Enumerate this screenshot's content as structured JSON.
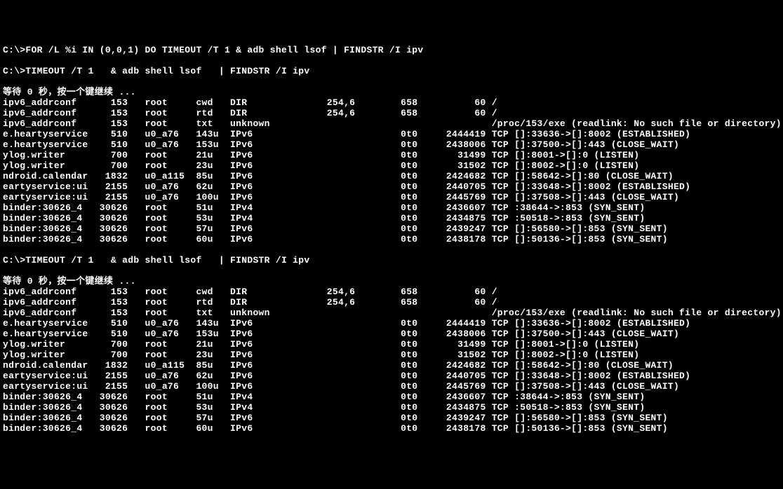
{
  "lines": [
    {
      "type": "cmd",
      "text": "C:\\>FOR /L %i IN (0,0,1) DO TIMEOUT /T 1 & adb shell lsof | FINDSTR /I ipv"
    },
    {
      "type": "blank",
      "text": ""
    },
    {
      "type": "cmd",
      "text": "C:\\>TIMEOUT /T 1   & adb shell lsof   | FINDSTR /I ipv"
    },
    {
      "type": "blank",
      "text": ""
    },
    {
      "type": "wait",
      "text": "等待 0 秒，按一个键继续 ..."
    },
    {
      "type": "row",
      "c0": "ipv6_addrconf",
      "c1": "153",
      "c2": "root",
      "c3": "cwd",
      "c4": "DIR",
      "c5": "254,6",
      "c6": "658",
      "c7": "60",
      "c8": "/"
    },
    {
      "type": "row",
      "c0": "ipv6_addrconf",
      "c1": "153",
      "c2": "root",
      "c3": "rtd",
      "c4": "DIR",
      "c5": "254,6",
      "c6": "658",
      "c7": "60",
      "c8": "/"
    },
    {
      "type": "row",
      "c0": "ipv6_addrconf",
      "c1": "153",
      "c2": "root",
      "c3": "txt",
      "c4": "unknown",
      "c5": "",
      "c6": "",
      "c7": "",
      "c8": "/proc/153/exe (readlink: No such file or directory)"
    },
    {
      "type": "row",
      "c0": "e.heartyservice",
      "c1": "510",
      "c2": "u0_a76",
      "c3": "143u",
      "c4": "IPv6",
      "c5": "",
      "c6": "0t0",
      "c7": "2444419",
      "c8": "TCP []:33636->[]:8002 (ESTABLISHED)"
    },
    {
      "type": "row",
      "c0": "e.heartyservice",
      "c1": "510",
      "c2": "u0_a76",
      "c3": "153u",
      "c4": "IPv6",
      "c5": "",
      "c6": "0t0",
      "c7": "2438006",
      "c8": "TCP []:37500->[]:443 (CLOSE_WAIT)"
    },
    {
      "type": "row",
      "c0": "ylog.writer",
      "c1": "700",
      "c2": "root",
      "c3": "21u",
      "c4": "IPv6",
      "c5": "",
      "c6": "0t0",
      "c7": "31499",
      "c8": "TCP []:8001->[]:0 (LISTEN)"
    },
    {
      "type": "row",
      "c0": "ylog.writer",
      "c1": "700",
      "c2": "root",
      "c3": "23u",
      "c4": "IPv6",
      "c5": "",
      "c6": "0t0",
      "c7": "31502",
      "c8": "TCP []:8002->[]:0 (LISTEN)"
    },
    {
      "type": "row",
      "c0": "ndroid.calendar",
      "c1": "1832",
      "c2": "u0_a115",
      "c3": "85u",
      "c4": "IPv6",
      "c5": "",
      "c6": "0t0",
      "c7": "2424682",
      "c8": "TCP []:58642->[]:80 (CLOSE_WAIT)"
    },
    {
      "type": "row",
      "c0": "eartyservice:ui",
      "c1": "2155",
      "c2": "u0_a76",
      "c3": "62u",
      "c4": "IPv6",
      "c5": "",
      "c6": "0t0",
      "c7": "2440705",
      "c8": "TCP []:33648->[]:8002 (ESTABLISHED)"
    },
    {
      "type": "row",
      "c0": "eartyservice:ui",
      "c1": "2155",
      "c2": "u0_a76",
      "c3": "100u",
      "c4": "IPv6",
      "c5": "",
      "c6": "0t0",
      "c7": "2445769",
      "c8": "TCP []:37508->[]:443 (CLOSE_WAIT)"
    },
    {
      "type": "row",
      "c0": "binder:30626_4",
      "c1": "30626",
      "c2": "root",
      "c3": "51u",
      "c4": "IPv4",
      "c5": "",
      "c6": "0t0",
      "c7": "2436607",
      "c8": "TCP :38644->:853 (SYN_SENT)"
    },
    {
      "type": "row",
      "c0": "binder:30626_4",
      "c1": "30626",
      "c2": "root",
      "c3": "53u",
      "c4": "IPv4",
      "c5": "",
      "c6": "0t0",
      "c7": "2434875",
      "c8": "TCP :50518->:853 (SYN_SENT)"
    },
    {
      "type": "row",
      "c0": "binder:30626_4",
      "c1": "30626",
      "c2": "root",
      "c3": "57u",
      "c4": "IPv6",
      "c5": "",
      "c6": "0t0",
      "c7": "2439247",
      "c8": "TCP []:56580->[]:853 (SYN_SENT)"
    },
    {
      "type": "row",
      "c0": "binder:30626_4",
      "c1": "30626",
      "c2": "root",
      "c3": "60u",
      "c4": "IPv6",
      "c5": "",
      "c6": "0t0",
      "c7": "2438178",
      "c8": "TCP []:50136->[]:853 (SYN_SENT)"
    },
    {
      "type": "blank",
      "text": ""
    },
    {
      "type": "cmd",
      "text": "C:\\>TIMEOUT /T 1   & adb shell lsof   | FINDSTR /I ipv"
    },
    {
      "type": "blank",
      "text": ""
    },
    {
      "type": "wait",
      "text": "等待 0 秒，按一个键继续 ..."
    },
    {
      "type": "row",
      "c0": "ipv6_addrconf",
      "c1": "153",
      "c2": "root",
      "c3": "cwd",
      "c4": "DIR",
      "c5": "254,6",
      "c6": "658",
      "c7": "60",
      "c8": "/"
    },
    {
      "type": "row",
      "c0": "ipv6_addrconf",
      "c1": "153",
      "c2": "root",
      "c3": "rtd",
      "c4": "DIR",
      "c5": "254,6",
      "c6": "658",
      "c7": "60",
      "c8": "/"
    },
    {
      "type": "row",
      "c0": "ipv6_addrconf",
      "c1": "153",
      "c2": "root",
      "c3": "txt",
      "c4": "unknown",
      "c5": "",
      "c6": "",
      "c7": "",
      "c8": "/proc/153/exe (readlink: No such file or directory)"
    },
    {
      "type": "row",
      "c0": "e.heartyservice",
      "c1": "510",
      "c2": "u0_a76",
      "c3": "143u",
      "c4": "IPv6",
      "c5": "",
      "c6": "0t0",
      "c7": "2444419",
      "c8": "TCP []:33636->[]:8002 (ESTABLISHED)"
    },
    {
      "type": "row",
      "c0": "e.heartyservice",
      "c1": "510",
      "c2": "u0_a76",
      "c3": "153u",
      "c4": "IPv6",
      "c5": "",
      "c6": "0t0",
      "c7": "2438006",
      "c8": "TCP []:37500->[]:443 (CLOSE_WAIT)"
    },
    {
      "type": "row",
      "c0": "ylog.writer",
      "c1": "700",
      "c2": "root",
      "c3": "21u",
      "c4": "IPv6",
      "c5": "",
      "c6": "0t0",
      "c7": "31499",
      "c8": "TCP []:8001->[]:0 (LISTEN)"
    },
    {
      "type": "row",
      "c0": "ylog.writer",
      "c1": "700",
      "c2": "root",
      "c3": "23u",
      "c4": "IPv6",
      "c5": "",
      "c6": "0t0",
      "c7": "31502",
      "c8": "TCP []:8002->[]:0 (LISTEN)"
    },
    {
      "type": "row",
      "c0": "ndroid.calendar",
      "c1": "1832",
      "c2": "u0_a115",
      "c3": "85u",
      "c4": "IPv6",
      "c5": "",
      "c6": "0t0",
      "c7": "2424682",
      "c8": "TCP []:58642->[]:80 (CLOSE_WAIT)"
    },
    {
      "type": "row",
      "c0": "eartyservice:ui",
      "c1": "2155",
      "c2": "u0_a76",
      "c3": "62u",
      "c4": "IPv6",
      "c5": "",
      "c6": "0t0",
      "c7": "2440705",
      "c8": "TCP []:33648->[]:8002 (ESTABLISHED)"
    },
    {
      "type": "row",
      "c0": "eartyservice:ui",
      "c1": "2155",
      "c2": "u0_a76",
      "c3": "100u",
      "c4": "IPv6",
      "c5": "",
      "c6": "0t0",
      "c7": "2445769",
      "c8": "TCP []:37508->[]:443 (CLOSE_WAIT)"
    },
    {
      "type": "row",
      "c0": "binder:30626_4",
      "c1": "30626",
      "c2": "root",
      "c3": "51u",
      "c4": "IPv4",
      "c5": "",
      "c6": "0t0",
      "c7": "2436607",
      "c8": "TCP :38644->:853 (SYN_SENT)"
    },
    {
      "type": "row",
      "c0": "binder:30626_4",
      "c1": "30626",
      "c2": "root",
      "c3": "53u",
      "c4": "IPv4",
      "c5": "",
      "c6": "0t0",
      "c7": "2434875",
      "c8": "TCP :50518->:853 (SYN_SENT)"
    },
    {
      "type": "row",
      "c0": "binder:30626_4",
      "c1": "30626",
      "c2": "root",
      "c3": "57u",
      "c4": "IPv6",
      "c5": "",
      "c6": "0t0",
      "c7": "2439247",
      "c8": "TCP []:56580->[]:853 (SYN_SENT)"
    },
    {
      "type": "row",
      "c0": "binder:30626_4",
      "c1": "30626",
      "c2": "root",
      "c3": "60u",
      "c4": "IPv6",
      "c5": "",
      "c6": "0t0",
      "c7": "2438178",
      "c8": "TCP []:50136->[]:853 (SYN_SENT)"
    }
  ]
}
